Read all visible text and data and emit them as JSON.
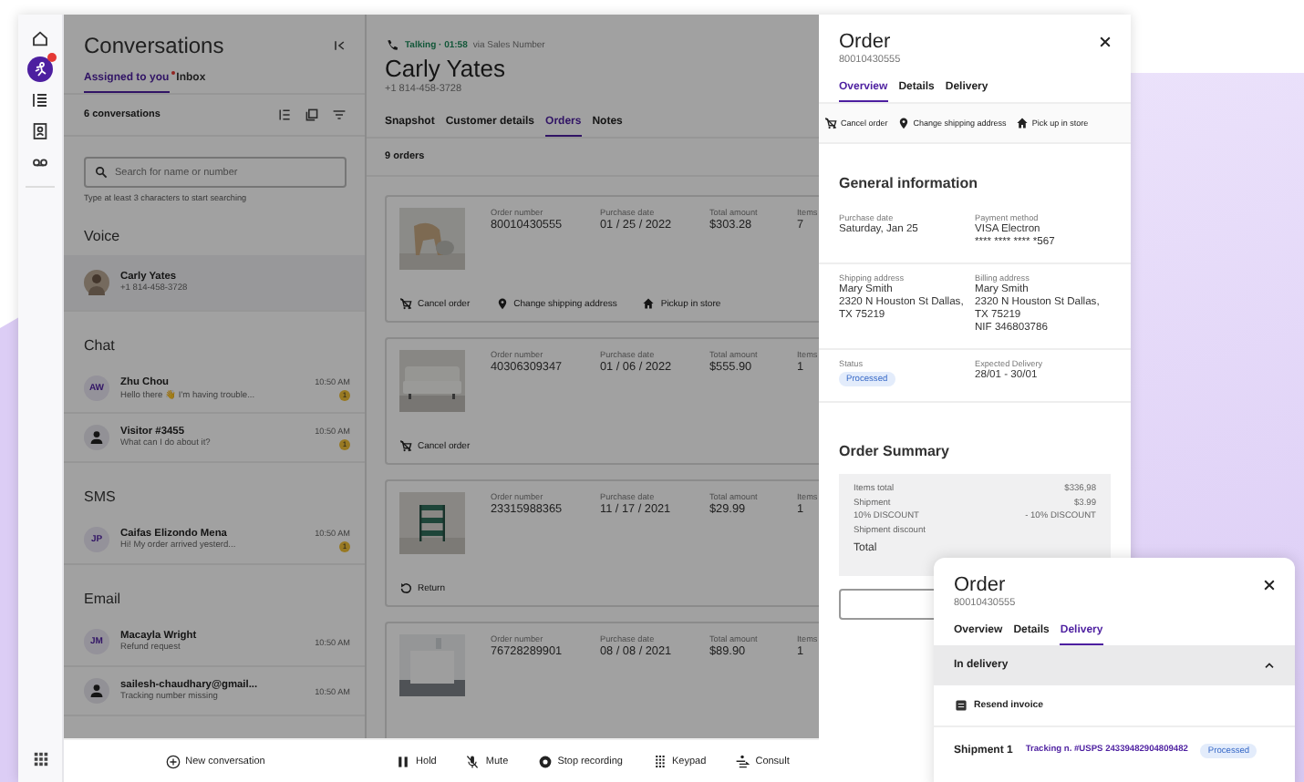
{
  "rail": {
    "items": [
      {
        "selected": false,
        "alert": false
      },
      {
        "selected": true,
        "alert": true
      },
      {
        "selected": false,
        "alert": false
      },
      {
        "selected": false,
        "alert": false
      },
      {
        "selected": false,
        "alert": false
      }
    ]
  },
  "conversations": {
    "title": "Conversations",
    "tabs": [
      {
        "label": "Assigned to you",
        "selected": true,
        "alert": true
      },
      {
        "label": "Inbox",
        "selected": false,
        "alert": false
      }
    ],
    "count": "6 conversations",
    "search": {
      "placeholder": "Search for name or number",
      "hint": "Type at least 3 characters to start searching"
    },
    "sections": [
      {
        "title": "Voice",
        "items": [
          {
            "name": "Carly Yates",
            "preview": "+1 814-458-3728",
            "selected": true
          }
        ]
      },
      {
        "title": "Chat",
        "items": [
          {
            "kind": "initials",
            "initials": "AW",
            "name": "Zhu Chou",
            "preview": "Hello there 👋 I'm having trouble...",
            "time": "10:50 AM",
            "unread": "1",
            "selected": false
          },
          {
            "kind": "person",
            "name": "Visitor #3455",
            "preview": "What can I do about it?",
            "time": "10:50 AM",
            "unread": "1",
            "selected": false
          }
        ]
      },
      {
        "title": "SMS",
        "items": [
          {
            "kind": "initials",
            "initials": "JP",
            "name": "Caifas Elizondo Mena",
            "preview": "Hi! My order arrived yesterd...",
            "time": "10:50 AM",
            "unread": "1",
            "selected": false
          }
        ]
      },
      {
        "title": "Email",
        "items": [
          {
            "kind": "initials",
            "initials": "JM",
            "name": "Macayla Wright",
            "preview": "Refund request",
            "time": "10:50 AM",
            "selected": false
          },
          {
            "kind": "person",
            "name": "sailesh-chaudhary@gmail...",
            "preview": "Tracking number missing",
            "time": "10:50 AM",
            "selected": false
          }
        ]
      }
    ],
    "new_button": "New conversation"
  },
  "customer": {
    "status": "Talking · 01:58",
    "via": "via Sales Number",
    "name": "Carly Yates",
    "phone": "+1 814-458-3728",
    "tabs": [
      {
        "label": "Snapshot",
        "selected": false
      },
      {
        "label": "Customer details",
        "selected": false
      },
      {
        "label": "Orders",
        "selected": true
      },
      {
        "label": "Notes",
        "selected": false
      }
    ],
    "count": "9 orders",
    "orders": [
      {
        "fields": [
          {
            "label": "Order number",
            "value": "80010430555"
          },
          {
            "label": "Purchase date",
            "value": "01 / 25 / 2022"
          },
          {
            "label": "Total amount",
            "value": "$303.28"
          },
          {
            "label": "Items",
            "value": "7"
          }
        ],
        "actions": [
          {
            "kind": "cancel",
            "label": "Cancel order"
          },
          {
            "kind": "location",
            "label": "Change shipping address"
          },
          {
            "kind": "store",
            "label": "Pickup in store"
          }
        ]
      },
      {
        "fields": [
          {
            "label": "Order number",
            "value": "40306309347"
          },
          {
            "label": "Purchase date",
            "value": "01 / 06 / 2022"
          },
          {
            "label": "Total amount",
            "value": "$555.90"
          },
          {
            "label": "Items",
            "value": "1"
          }
        ],
        "actions": [
          {
            "kind": "cancel",
            "label": "Cancel order"
          }
        ]
      },
      {
        "fields": [
          {
            "label": "Order number",
            "value": "23315988365"
          },
          {
            "label": "Purchase date",
            "value": "11 / 17 / 2021"
          },
          {
            "label": "Total amount",
            "value": "$29.99"
          },
          {
            "label": "Items",
            "value": "1"
          }
        ],
        "actions": [
          {
            "kind": "return",
            "label": "Return"
          }
        ]
      },
      {
        "fields": [
          {
            "label": "Order number",
            "value": "76728289901"
          },
          {
            "label": "Purchase date",
            "value": "08 / 08 / 2021"
          },
          {
            "label": "Total amount",
            "value": "$89.90"
          },
          {
            "label": "Items",
            "value": "1"
          }
        ]
      }
    ]
  },
  "call_bar": [
    {
      "kind": "hold",
      "label": "Hold"
    },
    {
      "kind": "mute",
      "label": "Mute"
    },
    {
      "kind": "record",
      "label": "Stop recording"
    },
    {
      "kind": "keypad",
      "label": "Keypad"
    },
    {
      "kind": "consult",
      "label": "Consult"
    }
  ],
  "order": {
    "title": "Order",
    "number": "80010430555",
    "tabs": [
      {
        "label": "Overview",
        "selected": true
      },
      {
        "label": "Details",
        "selected": false
      },
      {
        "label": "Delivery",
        "selected": false
      }
    ],
    "actions": [
      {
        "kind": "cancel",
        "label": "Cancel order"
      },
      {
        "kind": "location",
        "label": "Change shipping address"
      },
      {
        "kind": "store",
        "label": "Pick up in store"
      }
    ],
    "general_title": "General information",
    "info": [
      [
        {
          "label": "Purchase date",
          "lines": [
            "Saturday, Jan 25"
          ]
        },
        {
          "label": "Payment method",
          "lines": [
            "VISA Electron",
            "**** **** **** *567"
          ]
        }
      ],
      [
        {
          "label": "Shipping address",
          "lines": [
            "Mary Smith",
            "2320 N Houston St Dallas,",
            "TX 75219"
          ]
        },
        {
          "label": "Billing address",
          "lines": [
            "Mary Smith",
            "2320 N Houston St Dallas,",
            "TX 75219",
            "NIF 346803786"
          ]
        }
      ],
      [
        {
          "label": "Status",
          "badge": "Processed"
        },
        {
          "label": "Expected Delivery",
          "lines": [
            "28/01 - 30/01"
          ]
        }
      ]
    ],
    "summary_title": "Order Summary",
    "summary": [
      {
        "label": "Items total",
        "value": "$336,98"
      },
      {
        "label": "Shipment",
        "value": "$3.99"
      },
      {
        "label": "10% DISCOUNT",
        "value": "- 10% DISCOUNT"
      },
      {
        "label": "Shipment discount"
      }
    ],
    "total_label": "Total"
  },
  "delivery_card": {
    "title": "Order",
    "number": "80010430555",
    "tabs": [
      {
        "label": "Overview",
        "selected": false
      },
      {
        "label": "Details",
        "selected": false
      },
      {
        "label": "Delivery",
        "selected": true
      }
    ],
    "section": {
      "title": "In delivery",
      "expanded": true
    },
    "resend": "Resend invoice",
    "shipment": "Shipment 1",
    "tracking": "Tracking n. #USPS 24339482904809482",
    "status": "Processed"
  }
}
